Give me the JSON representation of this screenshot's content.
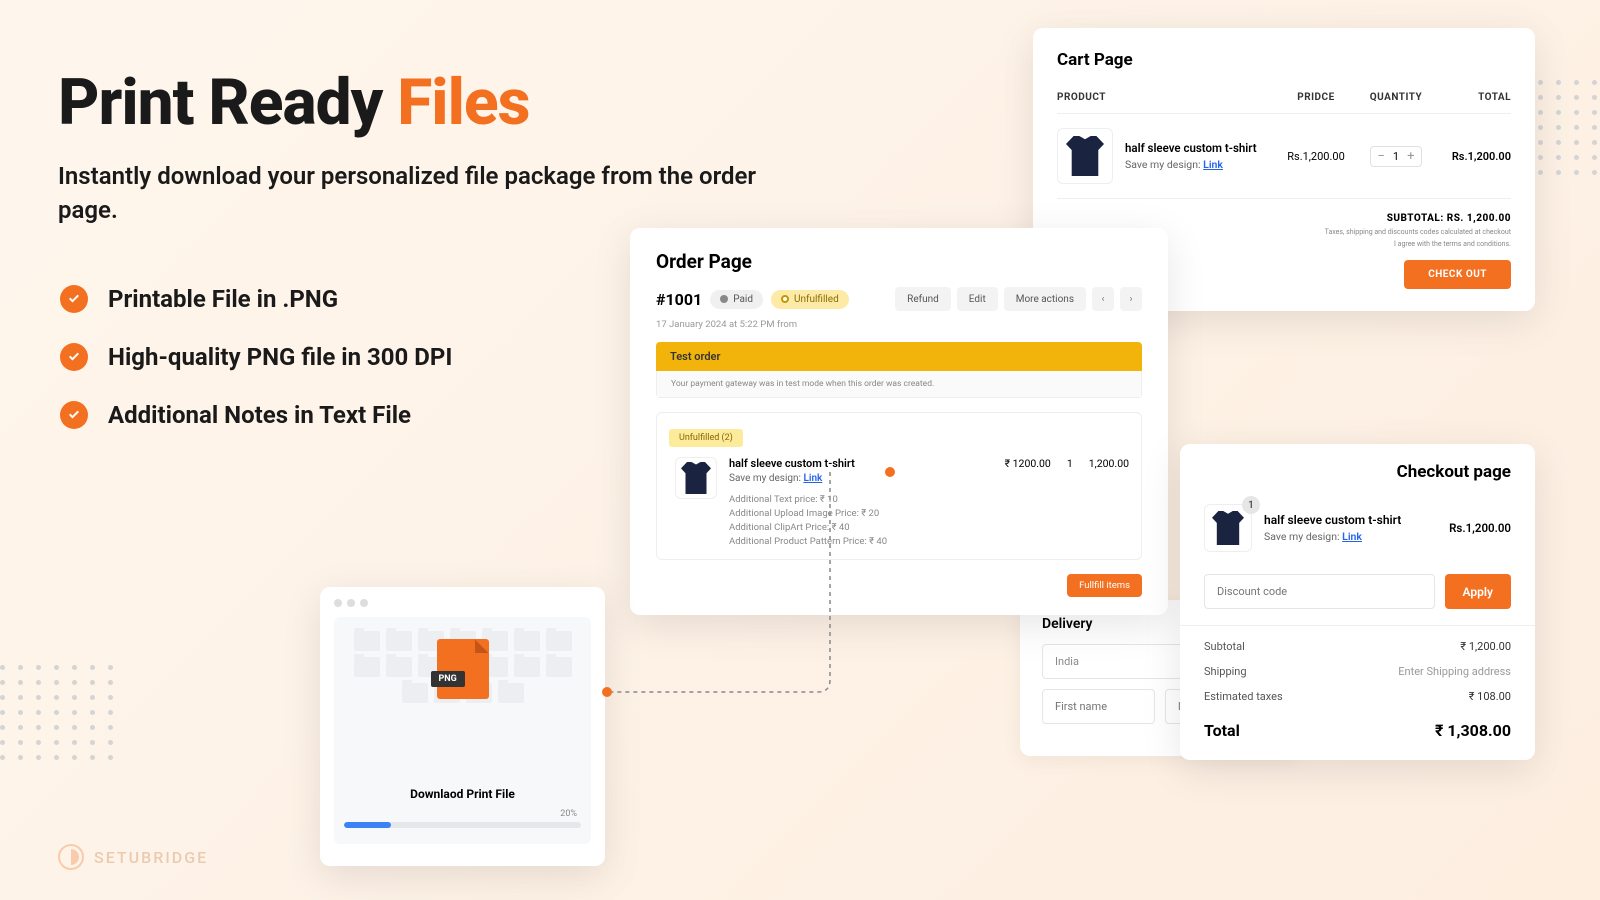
{
  "hero": {
    "title1": "Print Ready ",
    "title2": "Files",
    "sub": "Instantly download your personalized file package from the order page."
  },
  "features": [
    "Printable File in .PNG",
    "High-quality PNG file in 300 DPI",
    "Additional Notes in Text File"
  ],
  "cart": {
    "title": "Cart Page",
    "head": {
      "product": "PRODUCT",
      "price": "PRIDCE",
      "qty": "QUANTITY",
      "total": "TOTAL"
    },
    "item": {
      "name": "half sleeve custom t-shirt",
      "sub": "Save my design: ",
      "link": "Link",
      "price": "Rs.1,200.00",
      "qty": "1",
      "total": "Rs.1,200.00"
    },
    "subtotal": "SUBTOTAL: RS. 1,200.00",
    "note1": "Taxes, shipping and discounts codes calculated at checkout",
    "note2": "I agree with the terms and conditions.",
    "checkout": "CHECK OUT"
  },
  "order": {
    "title": "Order Page",
    "id": "#1001",
    "paid": "Paid",
    "unfulfilled": "Unfulfilled",
    "refund": "Refund",
    "edit": "Edit",
    "more": "More actions",
    "date": "17 January 2024 at 5:22 PM from",
    "test_head": "Test order",
    "test_body": "Your payment gateway was in test mode when this order was created.",
    "unful_badge": "Unfulfilled (2)",
    "item": {
      "name": "half sleeve custom t-shirt",
      "sub": "Save my design: ",
      "link": "Link",
      "price": "₹ 1200.00",
      "qty": "1",
      "total": "1,200.00"
    },
    "adds": [
      "Additional Text price:  ₹ 10",
      "Additional Upload Image Price:  ₹ 20",
      "Additional ClipArt Price: ₹ 40",
      "Additional Product Pattern Price: ₹ 40"
    ],
    "fulfill": "Fullfill items"
  },
  "download": {
    "label": "PNG",
    "text": "Downlaod Print File",
    "pct": "20%",
    "pct_val": 20
  },
  "checkout": {
    "title": "Checkout page",
    "badge": "1",
    "name": "half sleeve custom t-shirt",
    "sub": "Save my design: ",
    "link": "Link",
    "price": "Rs.1,200.00",
    "discount_ph": "Discount code",
    "apply": "Apply",
    "lines": [
      {
        "lbl": "Subtotal",
        "val": "₹ 1,200.00"
      },
      {
        "lbl": "Shipping",
        "val": "Enter Shipping address"
      },
      {
        "lbl": "Estimated taxes",
        "val": "₹ 108.00"
      }
    ],
    "total_lbl": "Total",
    "total_val": "₹ 1,308.00"
  },
  "delivery": {
    "title": "Delivery",
    "country": "India",
    "first": "First name",
    "last": "last name"
  },
  "brand": "SETUBRIDGE"
}
